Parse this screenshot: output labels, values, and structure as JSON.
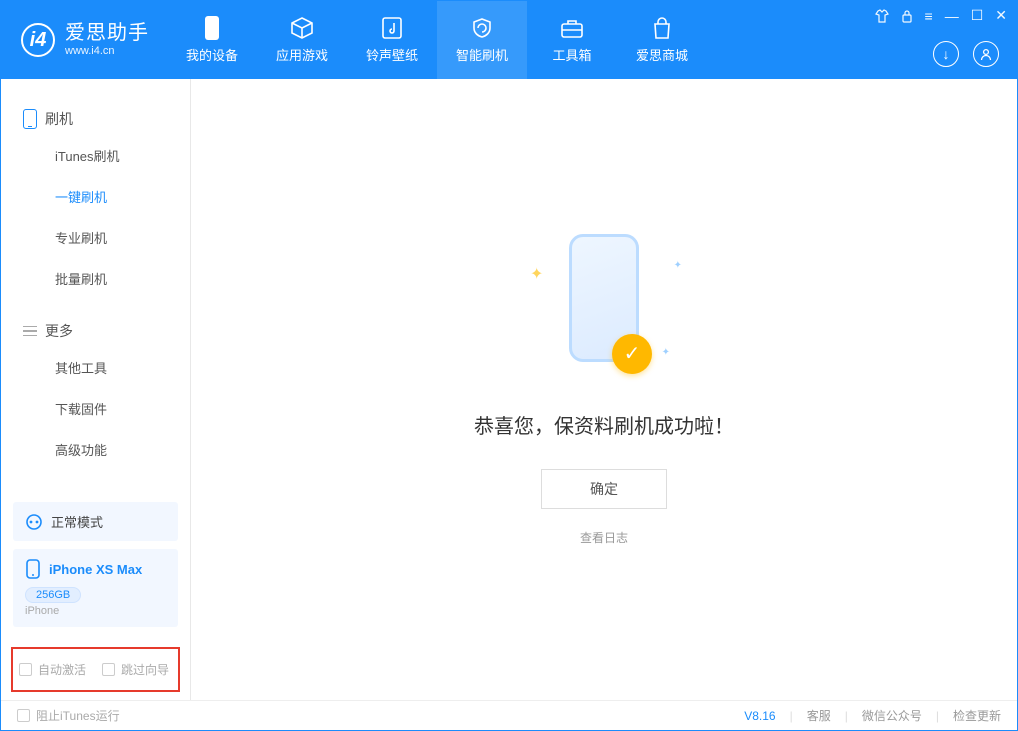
{
  "app": {
    "title": "爱思助手",
    "subtitle": "www.i4.cn"
  },
  "nav": {
    "device": "我的设备",
    "apps": "应用游戏",
    "ringtones": "铃声壁纸",
    "flash": "智能刷机",
    "toolbox": "工具箱",
    "store": "爱思商城"
  },
  "sidebar": {
    "group_flash": "刷机",
    "items_flash": {
      "itunes": "iTunes刷机",
      "onekey": "一键刷机",
      "pro": "专业刷机",
      "batch": "批量刷机"
    },
    "group_more": "更多",
    "items_more": {
      "other": "其他工具",
      "download": "下载固件",
      "advanced": "高级功能"
    }
  },
  "device": {
    "mode_label": "正常模式",
    "name": "iPhone XS Max",
    "storage": "256GB",
    "family": "iPhone"
  },
  "checkboxes": {
    "auto_activate": "自动激活",
    "skip_guide": "跳过向导"
  },
  "main_panel": {
    "success_message": "恭喜您，保资料刷机成功啦！",
    "ok_button": "确定",
    "view_log": "查看日志"
  },
  "footer": {
    "block_itunes": "阻止iTunes运行",
    "version": "V8.16",
    "support": "客服",
    "wechat": "微信公众号",
    "check_update": "检查更新"
  }
}
